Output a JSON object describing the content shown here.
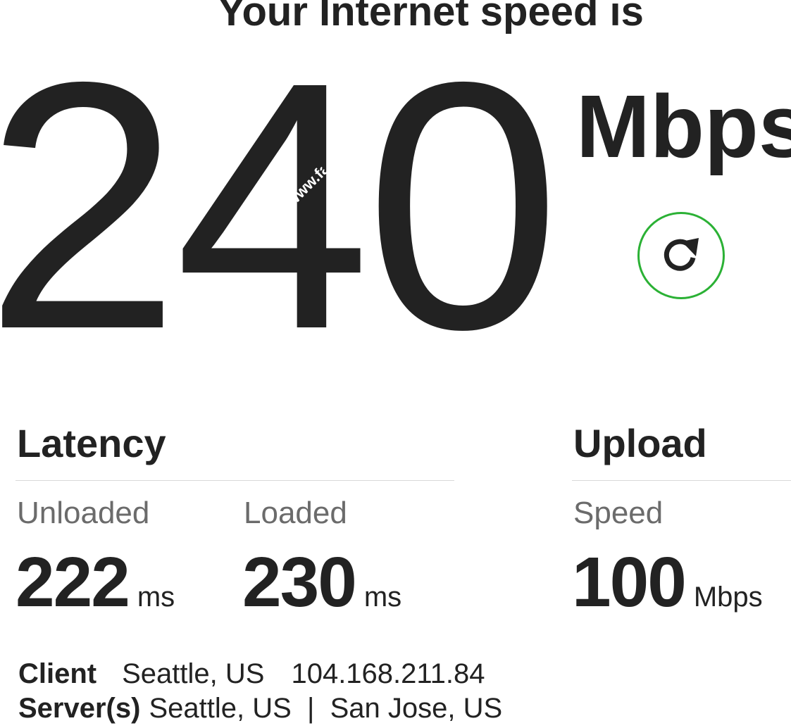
{
  "heading": "Your Internet speed is",
  "speed": {
    "value": "240",
    "unit": "Mbps"
  },
  "refresh": {
    "icon": "refresh-icon",
    "accent_color": "#2bb135"
  },
  "latency": {
    "title": "Latency",
    "unloaded": {
      "label": "Unloaded",
      "value": "222",
      "unit": "ms"
    },
    "loaded": {
      "label": "Loaded",
      "value": "230",
      "unit": "ms"
    }
  },
  "upload": {
    "title": "Upload",
    "speed": {
      "label": "Speed",
      "value": "100",
      "unit": "Mbps"
    }
  },
  "client": {
    "label": "Client",
    "location": "Seattle, US",
    "ip": "104.168.211.84"
  },
  "servers": {
    "label": "Server(s)",
    "list": "Seattle, US  |  San Jose, US"
  }
}
